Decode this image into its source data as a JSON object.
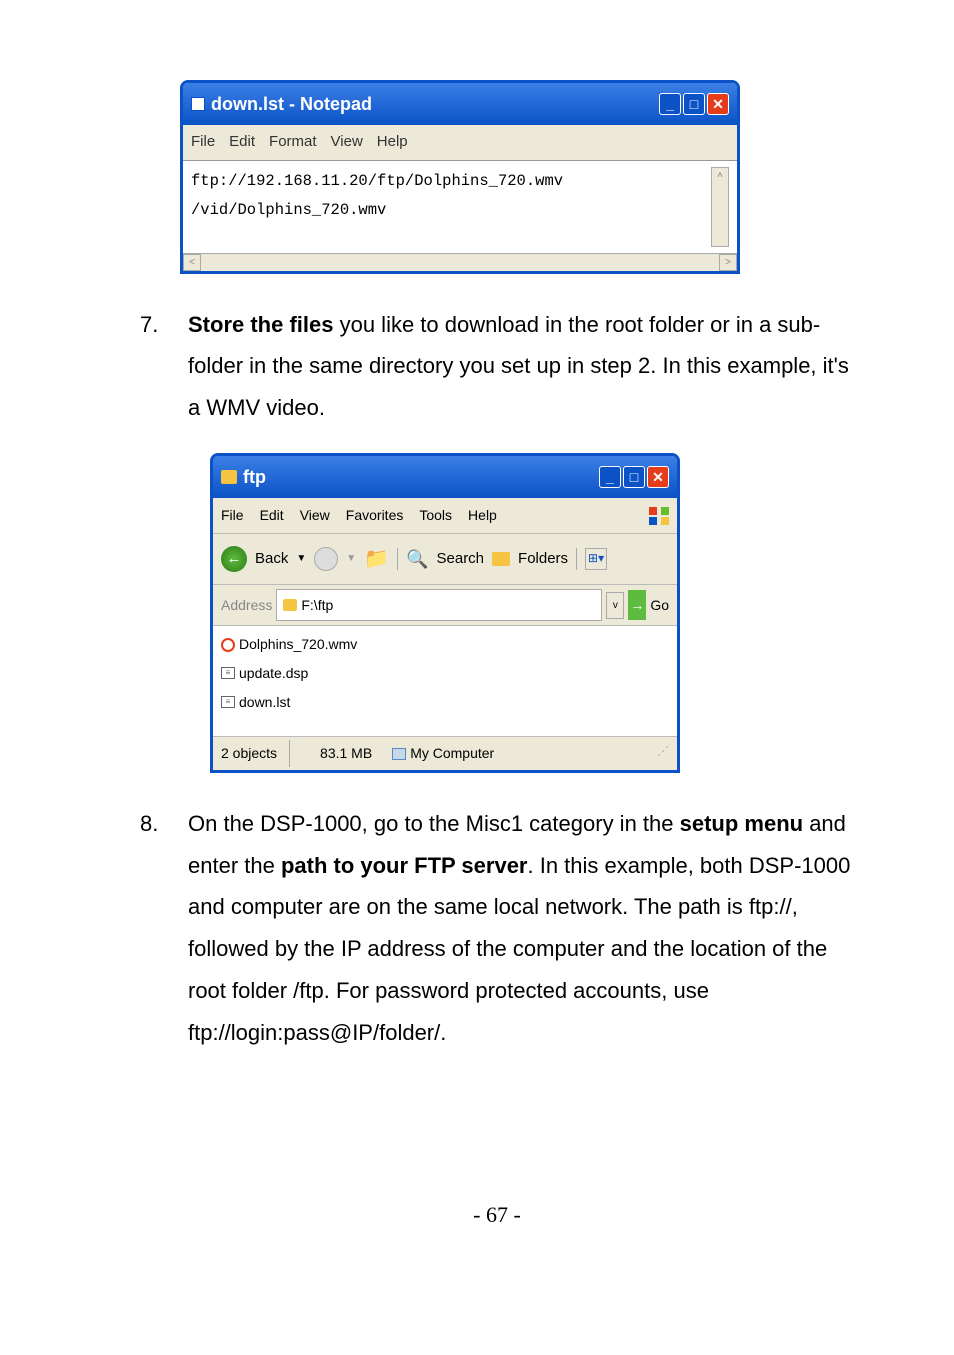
{
  "notepad": {
    "title": "down.lst - Notepad",
    "menu": {
      "file": "File",
      "edit": "Edit",
      "format": "Format",
      "view": "View",
      "help": "Help"
    },
    "content": "ftp://192.168.11.20/ftp/Dolphins_720.wmv /vid/Dolphins_720.wmv"
  },
  "step7": {
    "num": "7.",
    "bold": "Store the files",
    "rest": " you like to download in the root folder or in a sub-folder in the same directory you set up in step 2. In this example, it's a WMV video."
  },
  "explorer": {
    "title": "ftp",
    "menu": {
      "file": "File",
      "edit": "Edit",
      "view": "View",
      "favorites": "Favorites",
      "tools": "Tools",
      "help": "Help"
    },
    "toolbar": {
      "back": "Back",
      "search": "Search",
      "folders": "Folders",
      "go": "Go"
    },
    "address_label": "Address",
    "address_value": "F:\\ftp",
    "files": [
      {
        "icon": "wmv",
        "name": "Dolphins_720.wmv"
      },
      {
        "icon": "dsp",
        "name": "update.dsp"
      },
      {
        "icon": "dsp",
        "name": "down.lst"
      }
    ],
    "status": {
      "objects": "2 objects",
      "size": "83.1 MB",
      "location": "My Computer"
    }
  },
  "step8": {
    "num": "8.",
    "text_before_bold1": "On the DSP-1000, go to the Misc1 category in the ",
    "bold1": "setup menu",
    "between": " and enter the ",
    "bold2": "path to your FTP server",
    "after": ". In this example, both DSP-1000 and computer are on the same local network. The path is ftp://, followed by the IP address of the computer and the location of the root folder /ftp. For password protected accounts, use ftp://login:pass@IP/folder/."
  },
  "page_number": "- 67 -"
}
